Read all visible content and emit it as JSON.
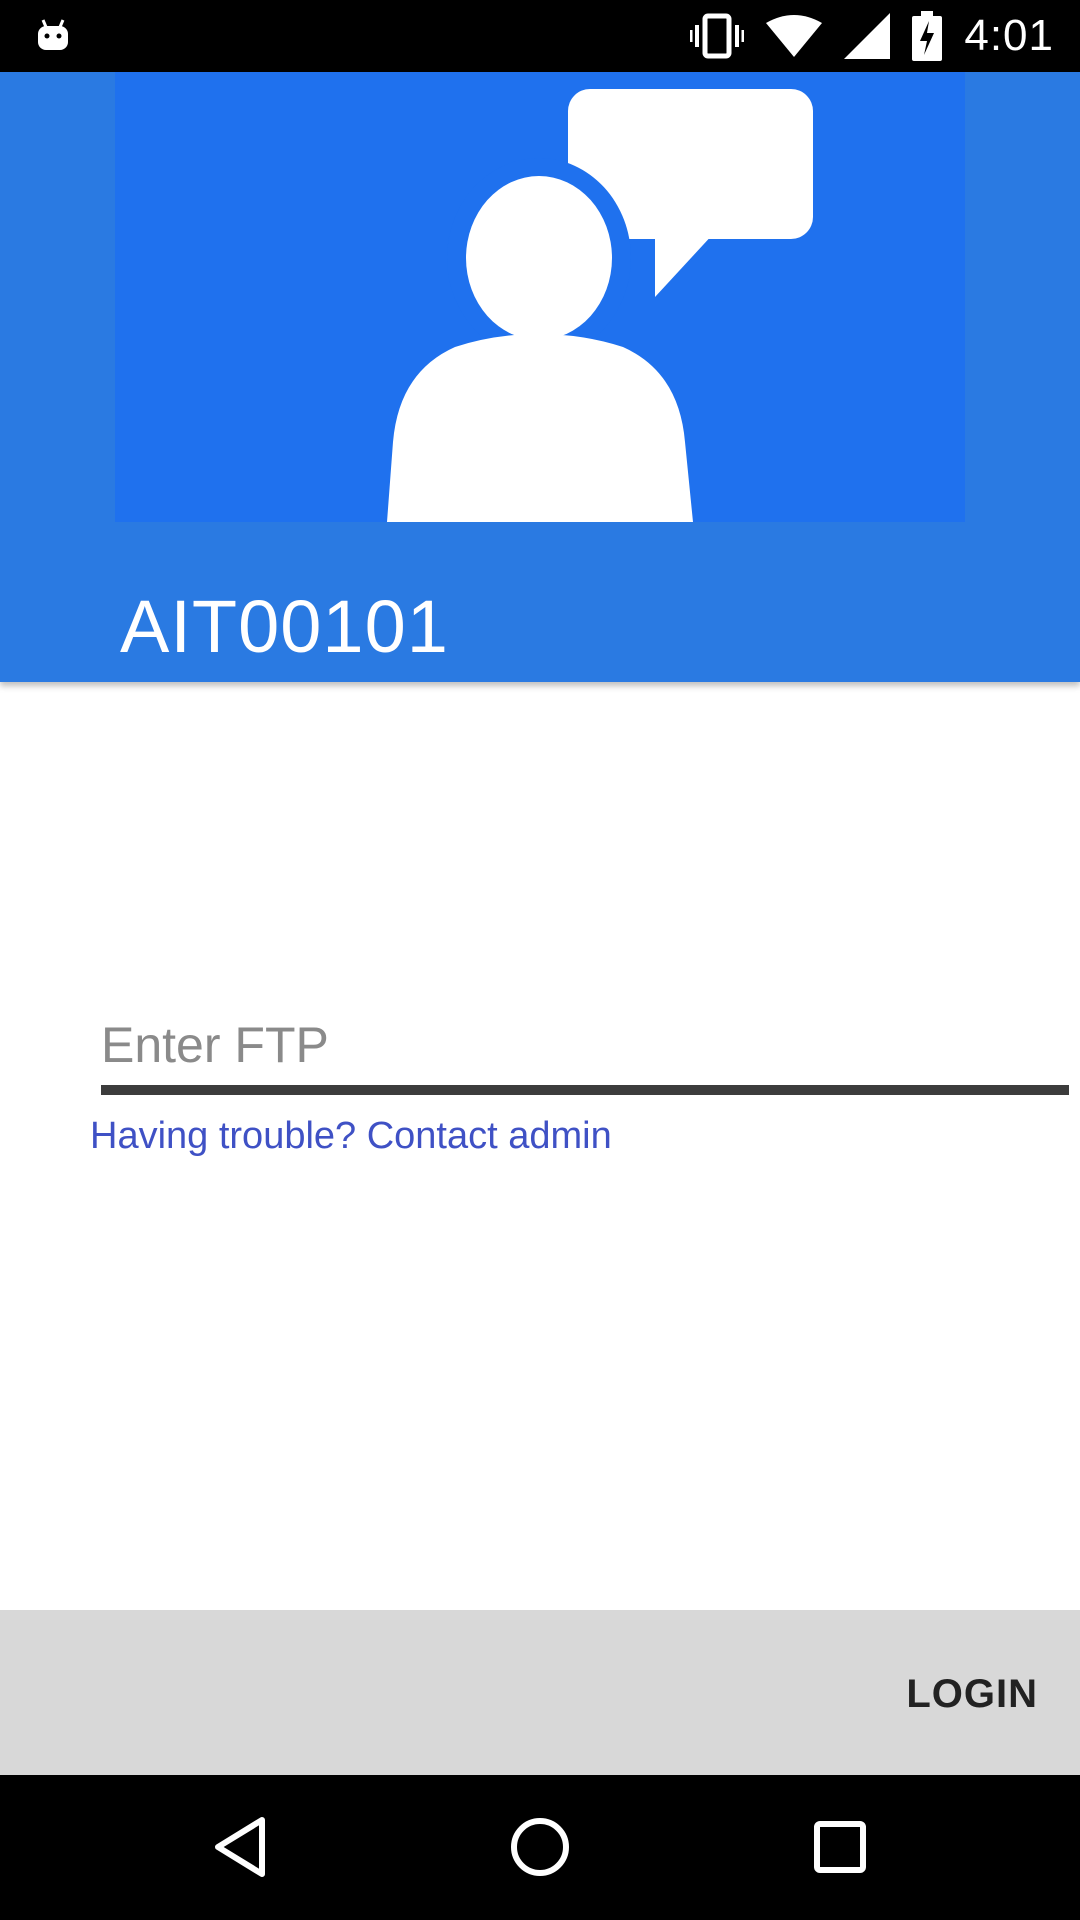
{
  "status_bar": {
    "time": "4:01",
    "icons": [
      "android-notification-icon",
      "vibrate-icon",
      "wifi-icon",
      "signal-icon",
      "battery-charging-icon"
    ]
  },
  "header": {
    "title": "AIT00101",
    "image": "person-speech-bubble-icon",
    "color": "#2a7ae2"
  },
  "form": {
    "ftp_placeholder": "Enter FTP",
    "ftp_value": "",
    "help_link": "Having trouble? Contact admin"
  },
  "footer": {
    "login_label": "LOGIN"
  },
  "nav_bar": {
    "buttons": [
      "back-icon",
      "home-icon",
      "recents-icon"
    ]
  }
}
